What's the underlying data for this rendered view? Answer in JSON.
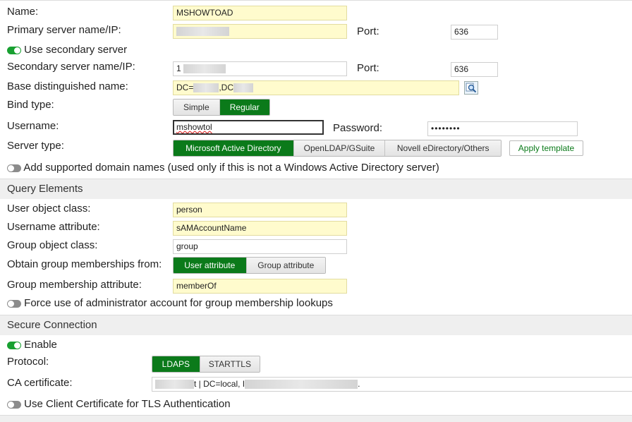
{
  "general": {
    "name_label": "Name:",
    "name_value": "MSHOWTOAD",
    "primary_label": "Primary server name/IP:",
    "primary_value": "",
    "port_label": "Port:",
    "primary_port": "636",
    "secondary_toggle_label": "Use secondary server",
    "secondary_label": "Secondary server name/IP:",
    "secondary_value": "1",
    "secondary_port": "636",
    "basedn_label": "Base distinguished name:",
    "basedn_part1": "DC=",
    "basedn_part2": ",DC",
    "bind_label": "Bind type:",
    "bind_options": [
      "Simple",
      "Regular"
    ],
    "bind_selected": "Regular",
    "username_label": "Username:",
    "username_value": "mshowtol",
    "password_label": "Password:",
    "password_value": "••••••••",
    "server_type_label": "Server type:",
    "server_types": [
      "Microsoft Active Directory",
      "OpenLDAP/GSuite",
      "Novell eDirectory/Others"
    ],
    "server_type_selected": "Microsoft Active Directory",
    "apply_template_label": "Apply template",
    "domain_toggle_label": "Add supported domain names (used only if this is not a Windows Active Directory server)"
  },
  "query": {
    "title": "Query Elements",
    "user_class_label": "User object class:",
    "user_class_value": "person",
    "username_attr_label": "Username attribute:",
    "username_attr_value": "sAMAccountName",
    "group_class_label": "Group object class:",
    "group_class_value": "group",
    "memberships_label": "Obtain group memberships from:",
    "membership_options": [
      "User attribute",
      "Group attribute"
    ],
    "membership_selected": "User attribute",
    "membership_attr_label": "Group membership attribute:",
    "membership_attr_value": "memberOf",
    "force_admin_label": "Force use of administrator account for group membership lookups"
  },
  "secure": {
    "title": "Secure Connection",
    "enable_label": "Enable",
    "protocol_label": "Protocol:",
    "protocol_options": [
      "LDAPS",
      "STARTTLS"
    ],
    "protocol_selected": "LDAPS",
    "ca_label": "CA certificate:",
    "ca_value_part1": "t | DC=local, I",
    "ca_value_part2": ".",
    "client_cert_label": "Use Client Certificate for TLS Authentication"
  },
  "colors": {
    "accent": "#0b7a1a",
    "toggle_on": "#18a031",
    "toggle_off": "#8c8c8c",
    "highlight_field": "#fffbcd"
  },
  "icons": [
    "toggle-on-icon",
    "toggle-off-icon",
    "browse-search-icon"
  ]
}
